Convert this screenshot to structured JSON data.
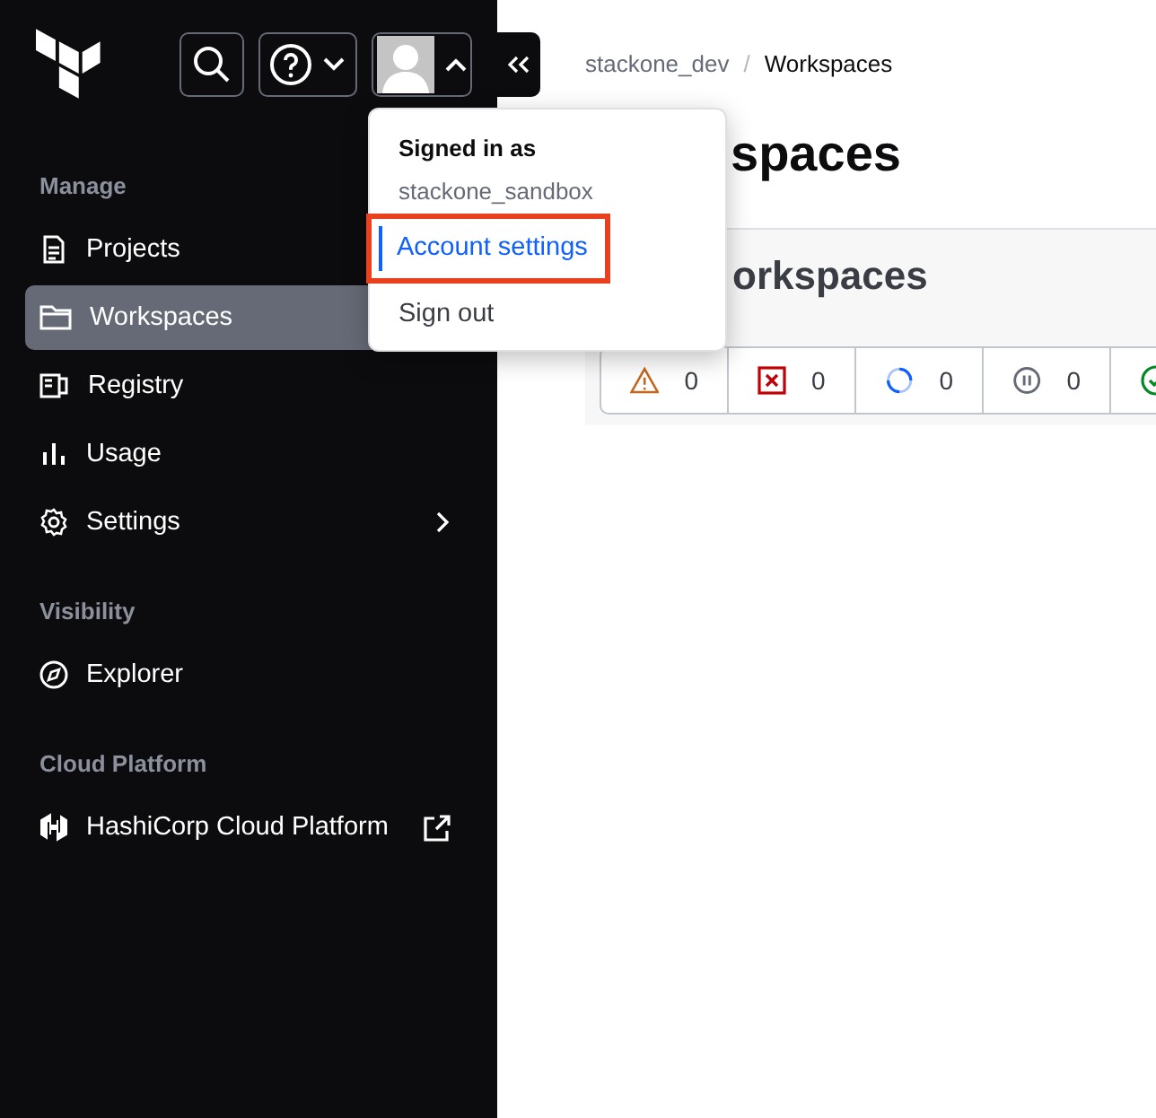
{
  "sidebar": {
    "sections": [
      {
        "label": "Manage",
        "items": [
          {
            "label": "Projects",
            "kind": "link",
            "selected": false
          },
          {
            "label": "Workspaces",
            "kind": "link",
            "selected": true
          },
          {
            "label": "Registry",
            "kind": "link",
            "selected": false
          },
          {
            "label": "Usage",
            "kind": "link",
            "selected": false
          },
          {
            "label": "Settings",
            "kind": "submenu",
            "selected": false
          }
        ]
      },
      {
        "label": "Visibility",
        "items": [
          {
            "label": "Explorer",
            "kind": "link",
            "selected": false
          }
        ]
      },
      {
        "label": "Cloud Platform",
        "items": [
          {
            "label": "HashiCorp Cloud Platform",
            "kind": "external",
            "selected": false
          }
        ]
      }
    ]
  },
  "breadcrumb": {
    "items": [
      "stackone_dev",
      "Workspaces"
    ],
    "separator": "/"
  },
  "page_title": "spaces",
  "section_title": "orkspaces",
  "status_filters": [
    {
      "kind": "warning",
      "count": "0"
    },
    {
      "kind": "error",
      "count": "0"
    },
    {
      "kind": "running",
      "count": "0"
    },
    {
      "kind": "paused",
      "count": "0"
    },
    {
      "kind": "success"
    }
  ],
  "account_menu": {
    "heading": "Signed in as",
    "username": "stackone_sandbox",
    "items": [
      {
        "label": "Account settings",
        "focused": true,
        "highlighted": true
      },
      {
        "label": "Sign out",
        "focused": false,
        "highlighted": false
      }
    ]
  }
}
